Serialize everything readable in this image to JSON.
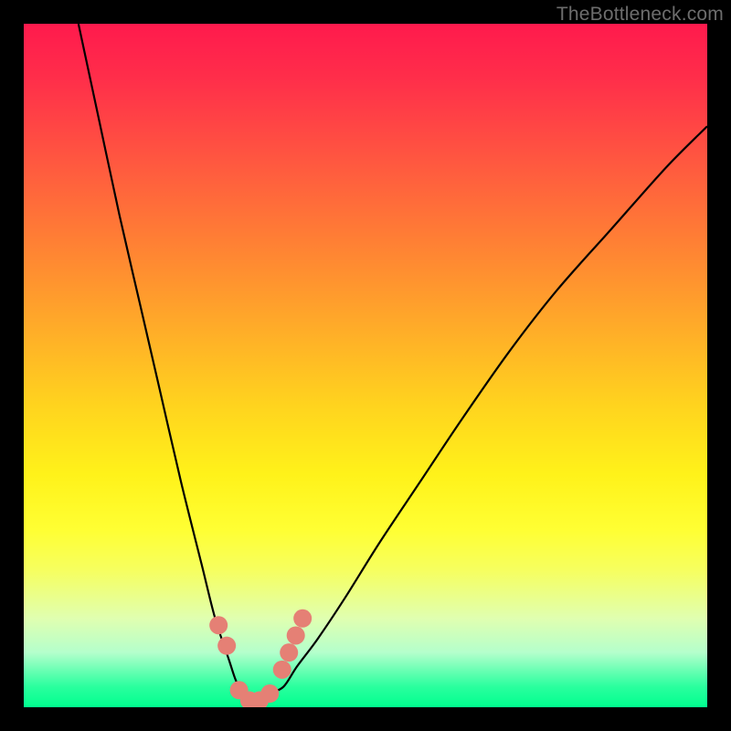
{
  "watermark": "TheBottleneck.com",
  "chart_data": {
    "type": "line",
    "title": "",
    "xlabel": "",
    "ylabel": "",
    "xlim": [
      0,
      100
    ],
    "ylim": [
      0,
      100
    ],
    "grid": false,
    "legend": false,
    "series": [
      {
        "name": "bottleneck-curve",
        "x": [
          8,
          11,
          14,
          17,
          20,
          23,
          26,
          28,
          30,
          31,
          32,
          33,
          34,
          35,
          36,
          38,
          40,
          43,
          47,
          52,
          58,
          64,
          71,
          78,
          86,
          94,
          100
        ],
        "y": [
          100,
          86,
          72,
          59,
          46,
          33,
          21,
          13,
          7,
          4,
          2,
          1,
          1,
          1,
          2,
          3,
          6,
          10,
          16,
          24,
          33,
          42,
          52,
          61,
          70,
          79,
          85
        ]
      },
      {
        "name": "sample-markers",
        "type": "scatter",
        "x": [
          28.5,
          29.7,
          31.5,
          33.0,
          34.5,
          36.0,
          37.8,
          38.8,
          39.8,
          40.8
        ],
        "y": [
          12.0,
          9.0,
          2.5,
          1.0,
          1.0,
          2.0,
          5.5,
          8.0,
          10.5,
          13.0
        ]
      }
    ],
    "background": "red-yellow-green vertical gradient",
    "annotations": [
      {
        "text": "TheBottleneck.com",
        "pos": "top-right",
        "role": "watermark"
      }
    ]
  },
  "colors": {
    "curve": "#000000",
    "marker_fill": "#e58075",
    "marker_stroke": "#b55",
    "frame": "#000000"
  }
}
